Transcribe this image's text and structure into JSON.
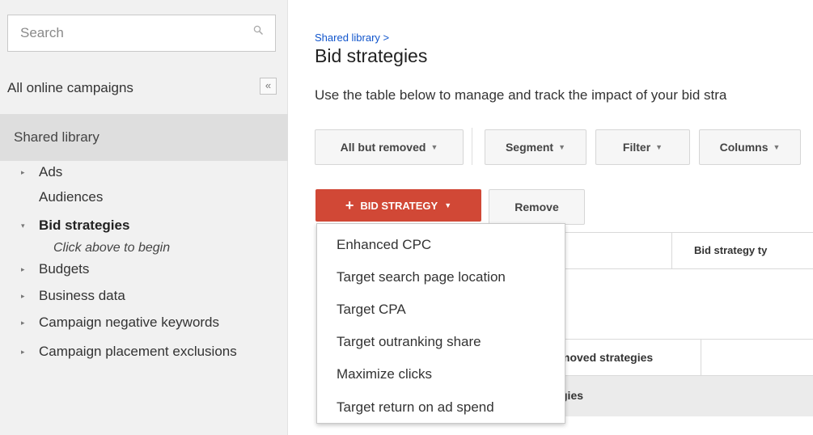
{
  "sidebar": {
    "search_placeholder": "Search",
    "all_campaigns": "All online campaigns",
    "collapse": "«",
    "shared_library": "Shared library",
    "tree": [
      {
        "label": "Ads",
        "arrow": "▸"
      },
      {
        "label": "Audiences",
        "arrow": ""
      },
      {
        "label": "Bid strategies",
        "arrow": "▾"
      },
      {
        "label": "Budgets",
        "arrow": "▸"
      },
      {
        "label": "Business data",
        "arrow": "▸"
      },
      {
        "label": "Campaign negative keywords",
        "arrow": "▸"
      },
      {
        "label": "Campaign placement exclusions",
        "arrow": "▸"
      }
    ],
    "hint": "Click above to begin"
  },
  "main": {
    "breadcrumb": "Shared library >",
    "title": "Bid strategies",
    "description": "Use the table below to manage and track the impact of your bid stra",
    "toolbar": {
      "filter_status": "All but removed",
      "segment": "Segment",
      "filter": "Filter",
      "columns": "Columns"
    },
    "actions": {
      "bid_strategy": "BID STRATEGY",
      "remove": "Remove"
    },
    "table": {
      "header_type": "Bid strategy ty",
      "removed_row": "moved strategies",
      "total_row": "gies"
    }
  },
  "dropdown": {
    "items": [
      "Enhanced CPC",
      "Target search page location",
      "Target CPA",
      "Target outranking share",
      "Maximize clicks",
      "Target return on ad spend"
    ]
  },
  "colors": {
    "primary_button": "#d14836",
    "link": "#1155cc",
    "sidebar_bg": "#f1f1f1",
    "selected_bg": "#dedede"
  }
}
